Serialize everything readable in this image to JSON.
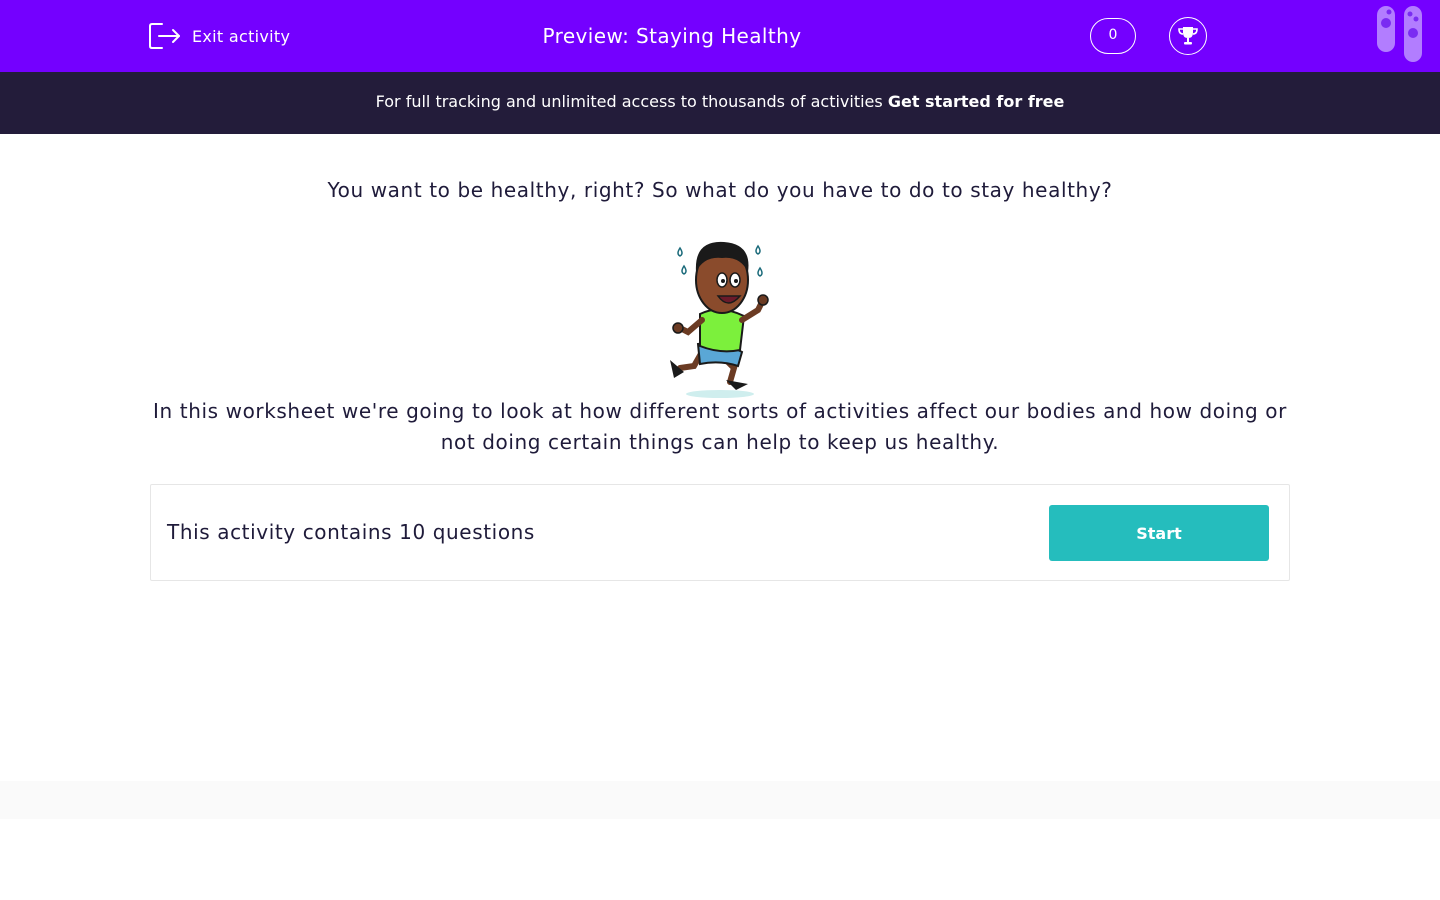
{
  "header": {
    "exit_label": "Exit activity",
    "title": "Preview: Staying Healthy",
    "score": "0",
    "icons": {
      "exit": "exit-icon",
      "trophy": "trophy-icon",
      "logo": "logo-icon"
    }
  },
  "banner": {
    "text": "For full tracking and unlimited access to thousands of activities",
    "cta": "Get started for free"
  },
  "main": {
    "intro": "You want to be healthy, right? So what do you have to do to stay healthy?",
    "description": "In this worksheet we're going to look at how different sorts of activities affect our bodies and how doing or not doing certain things can help to keep us healthy.",
    "question_count": "This activity contains 10 questions",
    "start_label": "Start"
  },
  "colors": {
    "header_bg": "#7400ff",
    "banner_bg": "#231c3a",
    "start_button": "#25bdbd",
    "text": "#1f1b3a"
  }
}
